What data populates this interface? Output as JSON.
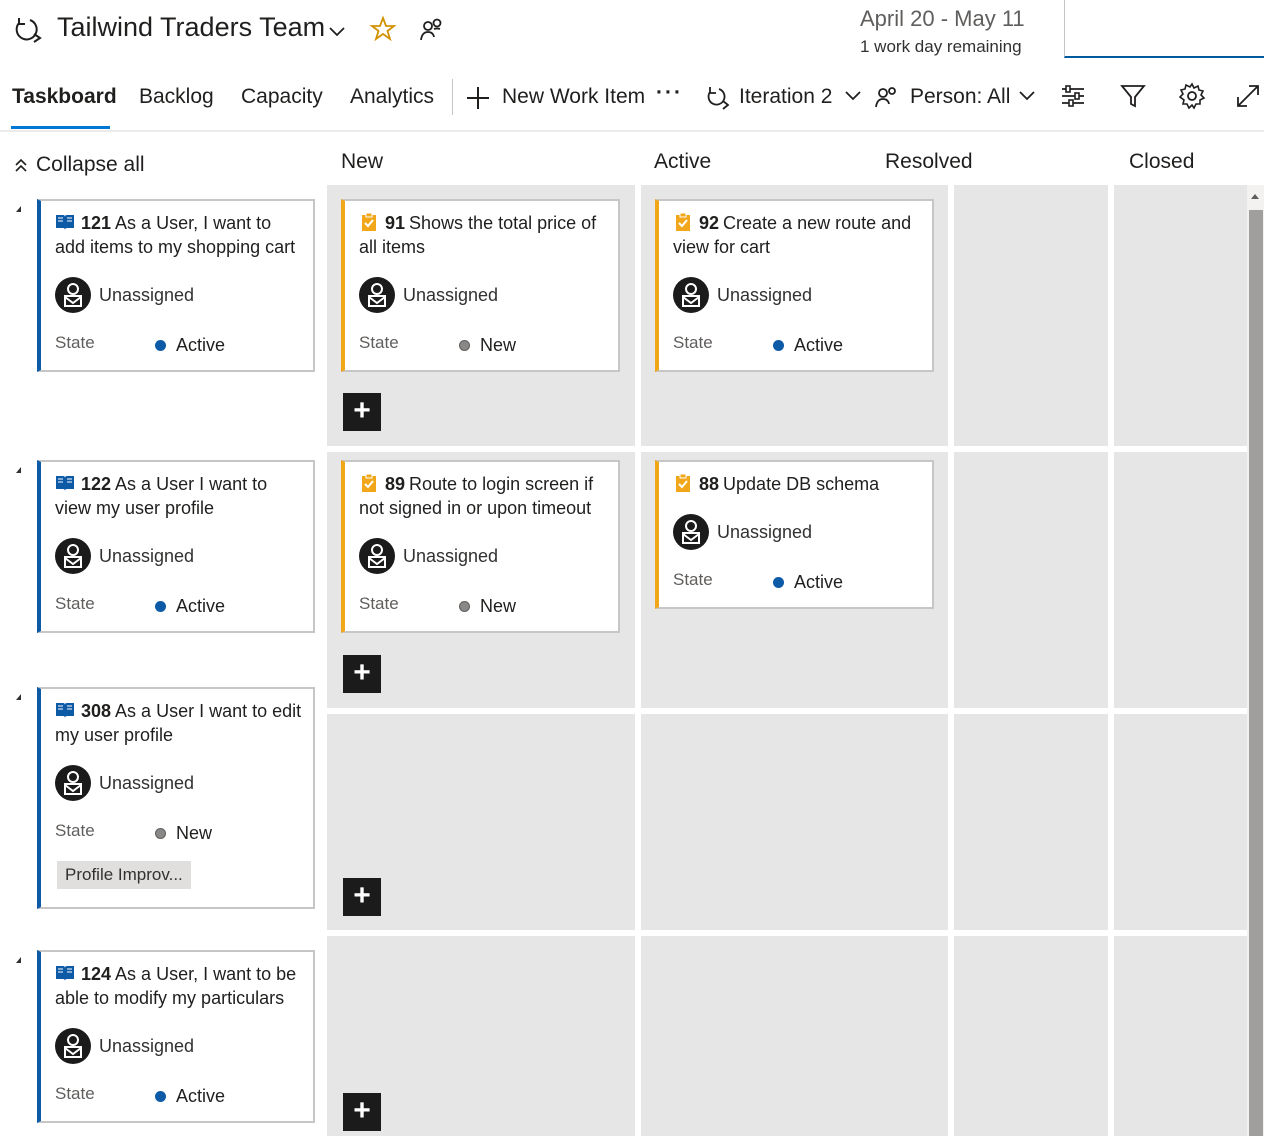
{
  "header": {
    "team_name": "Tailwind Traders Team",
    "dates": "April 20 - May 11",
    "days_remaining": "1 work day remaining"
  },
  "tabs": [
    {
      "label": "Taskboard",
      "active": true
    },
    {
      "label": "Backlog"
    },
    {
      "label": "Capacity"
    },
    {
      "label": "Analytics"
    }
  ],
  "toolbar": {
    "new_work_item": "New Work Item",
    "more": "···",
    "iteration": "Iteration 2",
    "person_filter": "Person: All"
  },
  "board": {
    "collapse_all": "Collapse all",
    "columns": [
      "New",
      "Active",
      "Resolved",
      "Closed"
    ],
    "state_label": "State",
    "unassigned": "Unassigned",
    "rows": [
      {
        "story": {
          "id": "121",
          "title": "As a User, I want to add items to my shopping cart",
          "state": "Active"
        },
        "tasks": [
          {
            "id": "91",
            "title": "Shows the total price of all items",
            "state": "New",
            "column": "New"
          },
          {
            "id": "92",
            "title": "Create a new route and view for cart",
            "state": "Active",
            "column": "Active"
          }
        ]
      },
      {
        "story": {
          "id": "122",
          "title": "As a User I want to view my user profile",
          "state": "Active"
        },
        "tasks": [
          {
            "id": "89",
            "title": "Route to login screen if not signed in or upon timeout",
            "state": "New",
            "column": "New"
          },
          {
            "id": "88",
            "title": "Update DB schema",
            "state": "Active",
            "column": "Active"
          }
        ]
      },
      {
        "story": {
          "id": "308",
          "title": "As a User I want to edit my user profile",
          "state": "New",
          "tag": "Profile Improv..."
        },
        "tasks": []
      },
      {
        "story": {
          "id": "124",
          "title": "As a User, I want to be able to modify my particulars",
          "state": "Active"
        },
        "tasks": []
      }
    ]
  },
  "colors": {
    "accent": "#0078d4",
    "story_border": "#0d5aa7",
    "task_border": "#f2a71b",
    "state_active": "#0d5aa7",
    "state_new": "#8a8886",
    "cell_bg": "#e6e6e6"
  },
  "icons": [
    "iteration-icon",
    "chevron-down-icon",
    "star-icon",
    "team-members-icon",
    "plus-icon",
    "person-icon",
    "settings-sliders-icon",
    "filter-icon",
    "gear-icon",
    "expand-icon",
    "book-icon",
    "clipboard-check-icon",
    "avatar-icon",
    "collapse-icon"
  ]
}
